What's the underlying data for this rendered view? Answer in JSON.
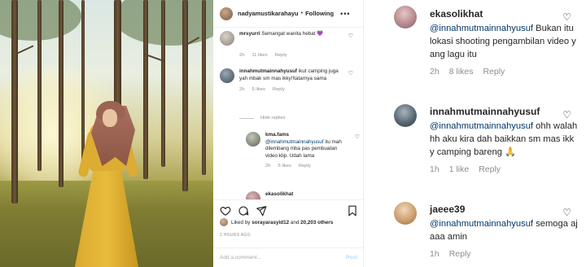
{
  "post": {
    "username": "nadyamustikarahayu",
    "separator": "•",
    "follow_label": "Following",
    "more_label": "•••",
    "photo_alt": "woman in yellow dress and hijab standing in pine forest"
  },
  "mini_comments": [
    {
      "username": "mrsyurri",
      "text": "Semangat wanita hebat 💜",
      "time": "2h",
      "likes": "11 likes",
      "reply": "Reply"
    },
    {
      "username": "innahmutmainnahyusuf",
      "text": "ikut camping juga yah mbak sm mas ikky!!tatarnya sama",
      "time": "2h",
      "likes": "5 likes",
      "reply": "Reply"
    },
    {
      "username": "kma.fams",
      "mention": "@innahmutmainnahyusuf",
      "text": "itu mah dilembang mba pas pembuatan video klip. Udah lama",
      "time": "2h",
      "likes": "5 likes",
      "reply": "Reply"
    },
    {
      "username": "ekasolikhat"
    }
  ],
  "hide_replies": "Hide replies",
  "liked_by": {
    "prefix": "Liked by",
    "user": "sorayarasyid12",
    "middle": "and",
    "count": "20,203 others"
  },
  "time_ago": "2 HOURS AGO",
  "add_comment": {
    "placeholder": "Add a comment...",
    "post_label": "Post"
  },
  "zoom_comments": [
    {
      "username": "ekasolikhat",
      "mention": "@innahmutmainnahyusuf",
      "text": "Bukan itu lokasi shooting pengambilan video yang lagu itu",
      "time": "2h",
      "likes": "8 likes",
      "reply": "Reply"
    },
    {
      "username": "innahmutmainnahyusuf",
      "mention": "@innahmutmainnahyusuf",
      "text": "ohh walahhh aku kira dah baikkan sm mas ikky camping bareng 🙏",
      "time": "1h",
      "likes": "1 like",
      "reply": "Reply"
    },
    {
      "username": "jaeee39",
      "mention": "@innahmutmainnahyusuf",
      "text": "semoga ajaaa amin",
      "time": "1h",
      "likes": "",
      "reply": "Reply"
    }
  ],
  "icons": [
    "heart-icon",
    "comment-icon",
    "share-icon",
    "bookmark-icon",
    "more-icon"
  ],
  "colors": {
    "link": "#00376b",
    "meta": "#8e8e8e",
    "text": "#262626",
    "post_disabled": "#b2dffc"
  }
}
